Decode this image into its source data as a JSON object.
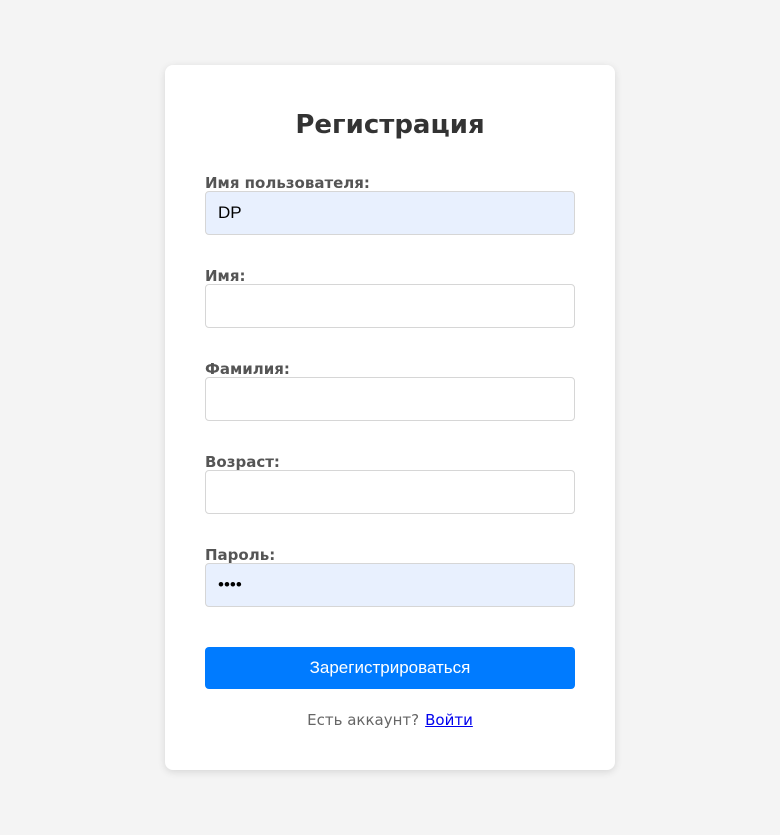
{
  "form": {
    "title": "Регистрация",
    "fields": [
      {
        "label": "Имя пользователя:",
        "value": "DP",
        "placeholder": "",
        "type": "text"
      },
      {
        "label": "Имя:",
        "value": "",
        "placeholder": "",
        "type": "text"
      },
      {
        "label": "Фамилия:",
        "value": "",
        "placeholder": "",
        "type": "text"
      },
      {
        "label": "Возраст:",
        "value": "",
        "placeholder": "",
        "type": "text"
      },
      {
        "label": "Пароль:",
        "value": "••••",
        "placeholder": "",
        "type": "password"
      }
    ],
    "submit_label": "Зарегистрироваться",
    "footer_text": "Есть аккаунт?",
    "login_link": "Войти"
  },
  "colors": {
    "background": "#f4f4f4",
    "card": "#ffffff",
    "accent": "#007bff",
    "autofill": "#e8f0fe",
    "link": "#0000ee"
  }
}
